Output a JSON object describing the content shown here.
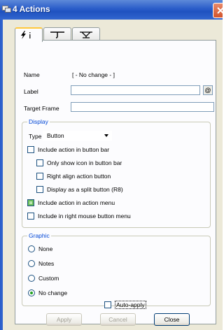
{
  "window": {
    "title": "4 Actions"
  },
  "tabs": [
    {
      "icon": "lightning-icon",
      "label": ""
    },
    {
      "icon": "hook-icon",
      "label": ""
    },
    {
      "icon": "sprinkler-icon",
      "label": ""
    }
  ],
  "form": {
    "name_label": "Name",
    "name_value": "[ - No change - ]",
    "label_label": "Label",
    "label_value": "",
    "label_button": "@",
    "target_frame_label": "Target Frame",
    "target_frame_value": ""
  },
  "display": {
    "title": "Display",
    "type_label": "Type",
    "type_value": "Button",
    "options": [
      {
        "label": "Include action in button bar",
        "checked": false
      },
      {
        "label": "Only show icon in button bar",
        "checked": false
      },
      {
        "label": "Right align action button",
        "checked": false
      },
      {
        "label": "Display as a split button (R8)",
        "checked": false
      },
      {
        "label": "Include action in action menu",
        "checked": true
      },
      {
        "label": "Include in right mouse button menu",
        "checked": false
      }
    ]
  },
  "graphic": {
    "title": "Graphic",
    "options": [
      {
        "label": "None",
        "checked": false
      },
      {
        "label": "Notes",
        "checked": false
      },
      {
        "label": "Custom",
        "checked": false
      },
      {
        "label": "No change",
        "checked": true
      }
    ]
  },
  "footer": {
    "auto_apply_label": "Auto-apply",
    "auto_apply_checked": false,
    "apply_label": "Apply",
    "cancel_label": "Cancel",
    "close_label": "Close"
  }
}
